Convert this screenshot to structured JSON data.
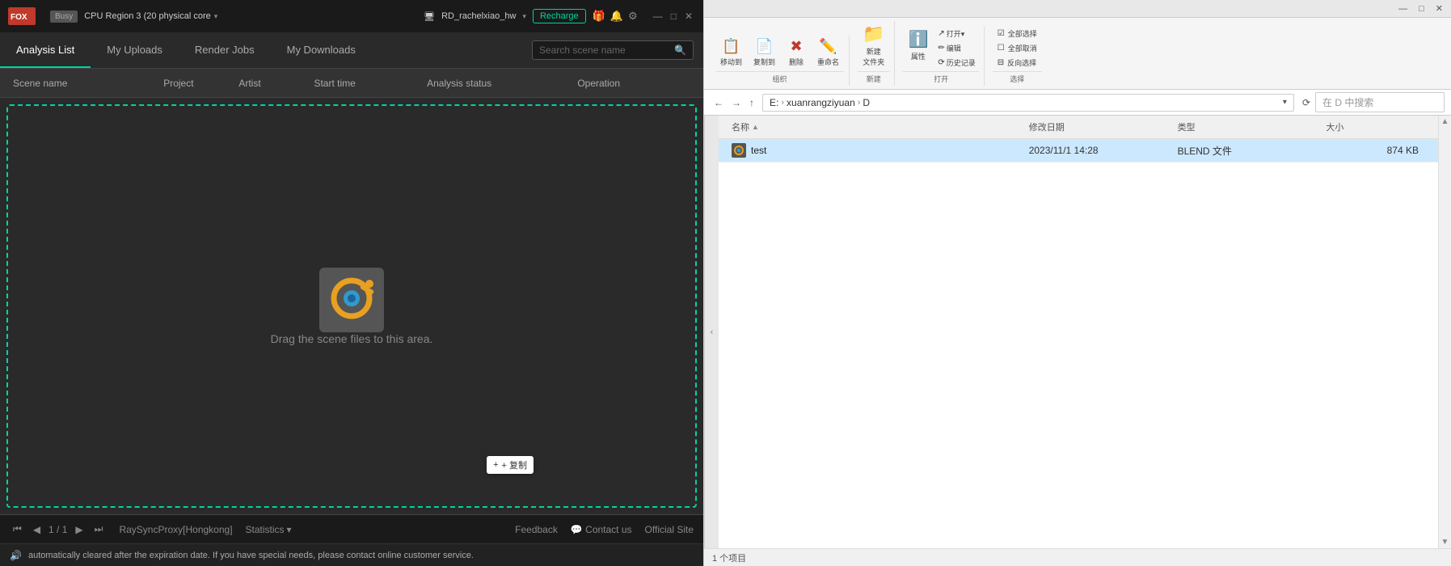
{
  "left": {
    "titlebar": {
      "logo": "Fox Renderfarm",
      "status": "Busy",
      "region": "CPU Region 3 (20 physical core",
      "user": "RD_rachelxiao_hw",
      "recharge": "Recharge"
    },
    "tabs": [
      {
        "id": "analysis-list",
        "label": "Analysis List",
        "active": true
      },
      {
        "id": "my-uploads",
        "label": "My Uploads",
        "active": false
      },
      {
        "id": "render-jobs",
        "label": "Render Jobs",
        "active": false
      },
      {
        "id": "my-downloads",
        "label": "My Downloads",
        "active": false
      }
    ],
    "search_placeholder": "Search scene name",
    "table_headers": [
      "Scene name",
      "Project",
      "Artist",
      "Start time",
      "Analysis status",
      "Operation"
    ],
    "drop_text": "Drag the scene files to this area.",
    "copy_badge": "+ 复制",
    "footer": {
      "page_info": "1 / 1",
      "proxy": "RaySyncProxy[Hongkong]",
      "statistics": "Statistics",
      "feedback": "Feedback",
      "contact_us": "Contact us",
      "official_site": "Official Site"
    },
    "notification": "automatically cleared after the expiration date. If you have special needs, please contact online customer service."
  },
  "right": {
    "titlebar": {
      "minimize": "—",
      "maximize": "□",
      "close": "✕"
    },
    "ribbon": {
      "sections": [
        {
          "id": "organize",
          "label": "组织",
          "buttons": [
            {
              "id": "move-to",
              "icon": "→",
              "label": "移动到",
              "color": "green"
            },
            {
              "id": "copy-to",
              "icon": "⊞",
              "label": "复制到",
              "color": "green"
            },
            {
              "id": "delete",
              "icon": "✕",
              "label": "删除",
              "color": "red"
            },
            {
              "id": "rename",
              "icon": "✏",
              "label": "重命名",
              "color": "blue"
            }
          ]
        },
        {
          "id": "new",
          "label": "新建",
          "buttons": [
            {
              "id": "new-folder",
              "icon": "📁",
              "label": "新建\n文件夹",
              "color": "yellow"
            }
          ]
        },
        {
          "id": "open",
          "label": "打开",
          "buttons": [
            {
              "id": "properties",
              "icon": "☰",
              "label": "属性",
              "color": "normal"
            },
            {
              "id": "open-btn",
              "icon": "↗",
              "label": "打开▾",
              "color": "normal"
            },
            {
              "id": "edit",
              "icon": "✏",
              "label": "编辑",
              "color": "normal"
            },
            {
              "id": "history",
              "icon": "⟳",
              "label": "历史记录",
              "color": "normal"
            }
          ]
        },
        {
          "id": "select",
          "label": "选择",
          "buttons": [
            {
              "id": "select-all",
              "icon": "☑",
              "label": "全部选择",
              "color": "normal"
            },
            {
              "id": "select-none",
              "icon": "☐",
              "label": "全部取消",
              "color": "normal"
            },
            {
              "id": "invert",
              "icon": "⊟",
              "label": "反向选择",
              "color": "normal"
            }
          ]
        }
      ]
    },
    "address_bar": {
      "path_parts": [
        "E:",
        "xuanrangziyuan",
        "D"
      ],
      "search_placeholder": "在 D 中搜索"
    },
    "file_list": {
      "headers": [
        "名称",
        "修改日期",
        "类型",
        "大小"
      ],
      "files": [
        {
          "name": "test",
          "modified": "2023/11/1 14:28",
          "type": "BLEND 文件",
          "size": "874 KB",
          "icon": "blender"
        }
      ]
    },
    "statusbar_text": "1 个项目"
  }
}
